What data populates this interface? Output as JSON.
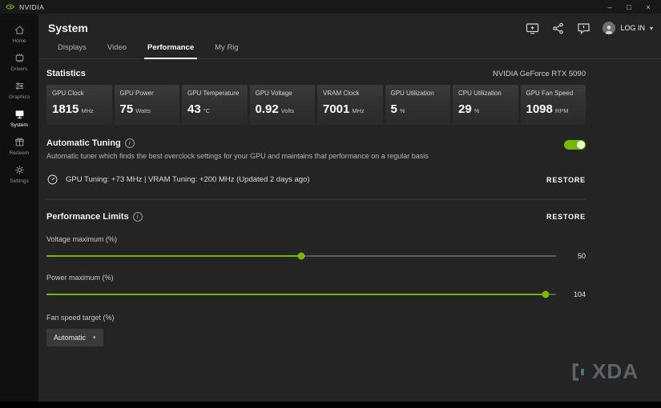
{
  "titlebar": {
    "app_name": "NVIDIA",
    "minimize_glyph": "–",
    "maximize_glyph": "□",
    "close_glyph": "×"
  },
  "sidebar": {
    "items": [
      {
        "label": "Home",
        "active": false
      },
      {
        "label": "Drivers",
        "active": false
      },
      {
        "label": "Graphics",
        "active": false
      },
      {
        "label": "System",
        "active": true
      },
      {
        "label": "Redeem",
        "active": false
      },
      {
        "label": "Settings",
        "active": false
      }
    ]
  },
  "header": {
    "title": "System",
    "login_label": "LOG IN",
    "chevron_glyph": "▾"
  },
  "tabs": [
    {
      "label": "Displays",
      "active": false
    },
    {
      "label": "Video",
      "active": false
    },
    {
      "label": "Performance",
      "active": true
    },
    {
      "label": "My Rig",
      "active": false
    }
  ],
  "statistics": {
    "heading": "Statistics",
    "gpu_name": "NVIDIA GeForce RTX 5090",
    "cards": [
      {
        "label": "GPU Clock",
        "value": "1815",
        "unit": "MHz"
      },
      {
        "label": "GPU Power",
        "value": "75",
        "unit": "Watts"
      },
      {
        "label": "GPU Temperature",
        "value": "43",
        "unit": "°C"
      },
      {
        "label": "GPU Voltage",
        "value": "0.92",
        "unit": "Volts"
      },
      {
        "label": "VRAM Clock",
        "value": "7001",
        "unit": "MHz"
      },
      {
        "label": "GPU Utilization",
        "value": "5",
        "unit": "%"
      },
      {
        "label": "CPU Utilization",
        "value": "29",
        "unit": "%"
      },
      {
        "label": "GPU Fan Speed",
        "value": "1098",
        "unit": "RPM"
      }
    ]
  },
  "automatic_tuning": {
    "title": "Automatic Tuning",
    "description": "Automatic tuner which finds the best overclock settings for your GPU and maintains that performance on a regular basis",
    "enabled": true,
    "status": "GPU Tuning: +73 MHz   |   VRAM Tuning: +200 MHz (Updated 2 days ago)",
    "restore_label": "RESTORE"
  },
  "performance_limits": {
    "title": "Performance Limits",
    "restore_label": "RESTORE",
    "sliders": [
      {
        "label": "Voltage maximum (%)",
        "value": "50",
        "fill_percent": 50
      },
      {
        "label": "Power maximum (%)",
        "value": "104",
        "fill_percent": 98
      }
    ],
    "fan_label": "Fan speed target (%)",
    "fan_selected": "Automatic",
    "caret_glyph": "▾"
  },
  "watermark": {
    "text": "XDA"
  },
  "colors": {
    "accent": "#76b900"
  }
}
